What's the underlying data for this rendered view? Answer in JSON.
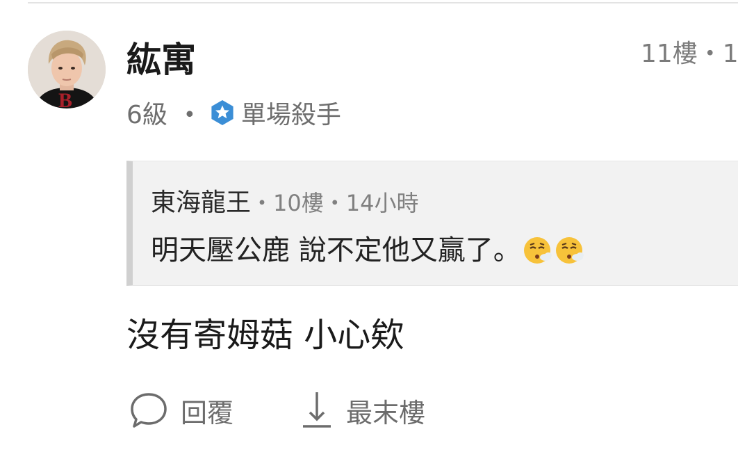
{
  "post": {
    "username": "紘寓",
    "floor_meta": "11樓・1",
    "level": "6級",
    "separator": "・",
    "badge": {
      "icon": "star-badge-icon",
      "color": "#3b8ed6",
      "title": "單場殺手"
    }
  },
  "quote": {
    "author": "東海龍王",
    "meta": "・10樓・14小時",
    "text": "明天壓公鹿  說不定他又贏了。",
    "emojis": [
      "face-exhaling-emoji",
      "face-exhaling-emoji"
    ]
  },
  "comment": {
    "text": "沒有寄姆菇 小心欸"
  },
  "actions": {
    "reply_label": "回覆",
    "reply_icon": "speech-bubble-icon",
    "last_floor_label": "最末樓",
    "last_floor_icon": "arrow-down-icon"
  }
}
